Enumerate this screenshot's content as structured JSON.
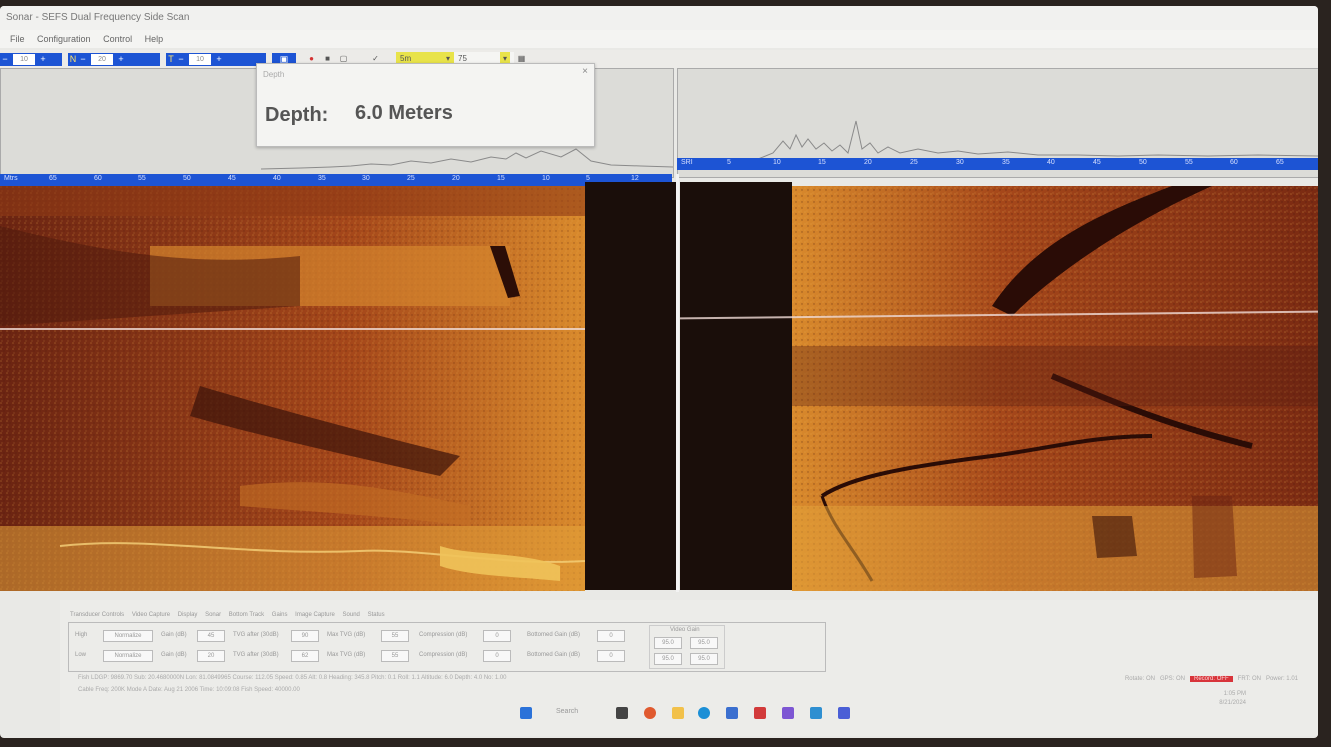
{
  "window": {
    "title": "Sonar - SEFS Dual Frequency Side Scan",
    "menu": [
      "File",
      "Configuration",
      "Control",
      "Help"
    ]
  },
  "toolbar": {
    "field1": "10",
    "field2": "20",
    "field3": "10",
    "dropdown1": "5m",
    "dropdown2": "75"
  },
  "depth_popup": {
    "caption": "Depth",
    "label": "Depth:",
    "value": "6.0 Meters"
  },
  "left_ruler": [
    "Mtrs",
    "65",
    "60",
    "55",
    "50",
    "45",
    "40",
    "35",
    "30",
    "25",
    "20",
    "15",
    "10",
    "5",
    "12"
  ],
  "right_ruler": [
    "SRI",
    "5",
    "10",
    "15",
    "20",
    "25",
    "30",
    "35",
    "40",
    "45",
    "50",
    "55",
    "60",
    "65"
  ],
  "tabs": [
    "Transducer Controls",
    "Video Capture",
    "Display",
    "Sonar",
    "Bottom Track",
    "Gains",
    "Image Capture",
    "Sound",
    "Status"
  ],
  "controls": {
    "rows": [
      {
        "label": "High",
        "button": "Normalize",
        "gain_label": "Gain (dB)",
        "gain": "45",
        "tvg_label": "TVG after (30dB)",
        "tvg": "90",
        "max_label": "Max TVG (dB)",
        "max": "55",
        "compress_label": "Compression (dB)",
        "compress": "0",
        "bottom_label": "Bottomed Gain (dB)",
        "bottom": "0"
      },
      {
        "label": "Low",
        "button": "Normalize",
        "gain_label": "Gain (dB)",
        "gain": "20",
        "tvg_label": "TVG after (30dB)",
        "tvg": "62",
        "max_label": "Max TVG (dB)",
        "max": "55",
        "compress_label": "Compression (dB)",
        "compress": "0",
        "bottom_label": "Bottomed Gain (dB)",
        "bottom": "0"
      }
    ],
    "video_gain": {
      "title": "Video Gain",
      "values": [
        "95.0",
        "95.0",
        "95.0",
        "95.0"
      ]
    }
  },
  "status_line1": "Fish LDGP: 9869.70  Sub: 20.4680000N  Lon: 81.0849965  Course: 112.05  Speed: 0.85  Alt: 0.8  Heading: 345.8  Pitch: 0.1  Roll: 1.1  Altitude: 6.0  Depth: 4.0  No: 1.00",
  "status_line2": "Cable Freq: 200K  Mode  A  Date: Aug 21 2006  Time: 10:09:08  Fish Speed: 40000.00",
  "status_right": {
    "items": [
      "Rotate: ON",
      "GPS: ON"
    ],
    "alert": "Record: OFF",
    "extra": [
      "FRT: ON",
      "Power: 1.01"
    ],
    "clock": "1:05 PM",
    "date": "8/21/2024"
  },
  "taskbar": {
    "search": "Search"
  },
  "colors": {
    "ruler": "#1d54d4",
    "sonar_light": "#e3a23a",
    "sonar_dark": "#5a1d10"
  }
}
